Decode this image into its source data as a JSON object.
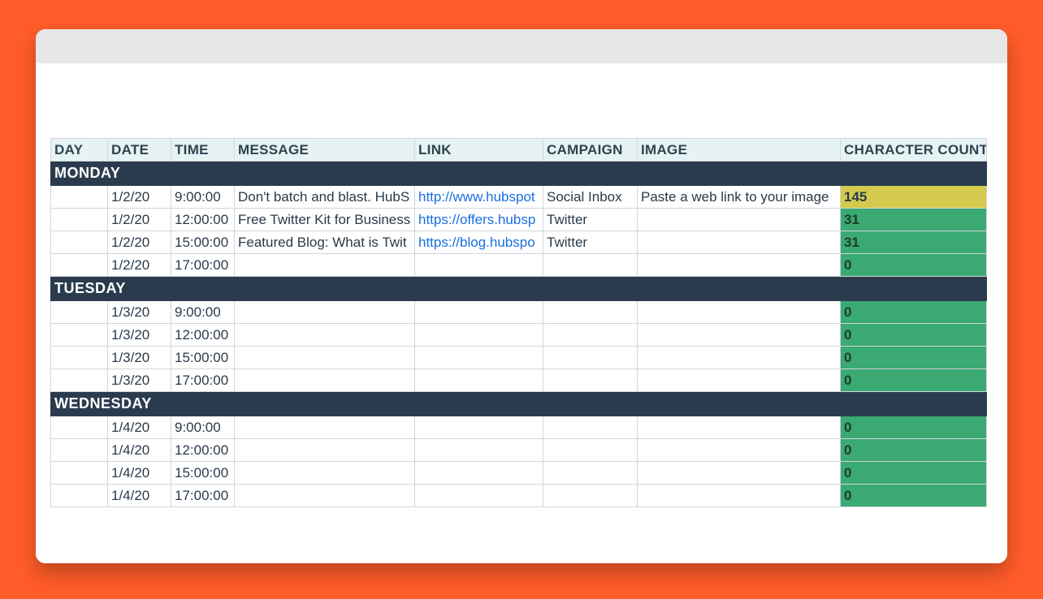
{
  "headers": {
    "day": "DAY",
    "date": "DATE",
    "time": "TIME",
    "message": "MESSAGE",
    "link": "LINK",
    "campaign": "CAMPAIGN",
    "image": "IMAGE",
    "count": "CHARACTER COUNT"
  },
  "sections": [
    {
      "label": "MONDAY",
      "rows": [
        {
          "date": "1/2/20",
          "time": "9:00:00",
          "message": "Don't batch and blast. HubS",
          "link": "http://www.hubspot",
          "campaign": "Social Inbox",
          "image": "Paste a web link to your image",
          "count": "145",
          "count_class": "warn"
        },
        {
          "date": "1/2/20",
          "time": "12:00:00",
          "message": "Free Twitter Kit for Business",
          "link": "https://offers.hubsp",
          "campaign": "Twitter",
          "image": "",
          "count": "31",
          "count_class": "ok"
        },
        {
          "date": "1/2/20",
          "time": "15:00:00",
          "message": "Featured Blog: What is Twit",
          "link": "https://blog.hubspo",
          "campaign": "Twitter",
          "image": "",
          "count": "31",
          "count_class": "ok"
        },
        {
          "date": "1/2/20",
          "time": "17:00:00",
          "message": "",
          "link": "",
          "campaign": "",
          "image": "",
          "count": "0",
          "count_class": "ok"
        }
      ]
    },
    {
      "label": "TUESDAY",
      "rows": [
        {
          "date": "1/3/20",
          "time": "9:00:00",
          "message": "",
          "link": "",
          "campaign": "",
          "image": "",
          "count": "0",
          "count_class": "ok"
        },
        {
          "date": "1/3/20",
          "time": "12:00:00",
          "message": "",
          "link": "",
          "campaign": "",
          "image": "",
          "count": "0",
          "count_class": "ok"
        },
        {
          "date": "1/3/20",
          "time": "15:00:00",
          "message": "",
          "link": "",
          "campaign": "",
          "image": "",
          "count": "0",
          "count_class": "ok"
        },
        {
          "date": "1/3/20",
          "time": "17:00:00",
          "message": "",
          "link": "",
          "campaign": "",
          "image": "",
          "count": "0",
          "count_class": "ok"
        }
      ]
    },
    {
      "label": "WEDNESDAY",
      "rows": [
        {
          "date": "1/4/20",
          "time": "9:00:00",
          "message": "",
          "link": "",
          "campaign": "",
          "image": "",
          "count": "0",
          "count_class": "ok"
        },
        {
          "date": "1/4/20",
          "time": "12:00:00",
          "message": "",
          "link": "",
          "campaign": "",
          "image": "",
          "count": "0",
          "count_class": "ok"
        },
        {
          "date": "1/4/20",
          "time": "15:00:00",
          "message": "",
          "link": "",
          "campaign": "",
          "image": "",
          "count": "0",
          "count_class": "ok"
        },
        {
          "date": "1/4/20",
          "time": "17:00:00",
          "message": "",
          "link": "",
          "campaign": "",
          "image": "",
          "count": "0",
          "count_class": "ok"
        }
      ]
    }
  ]
}
